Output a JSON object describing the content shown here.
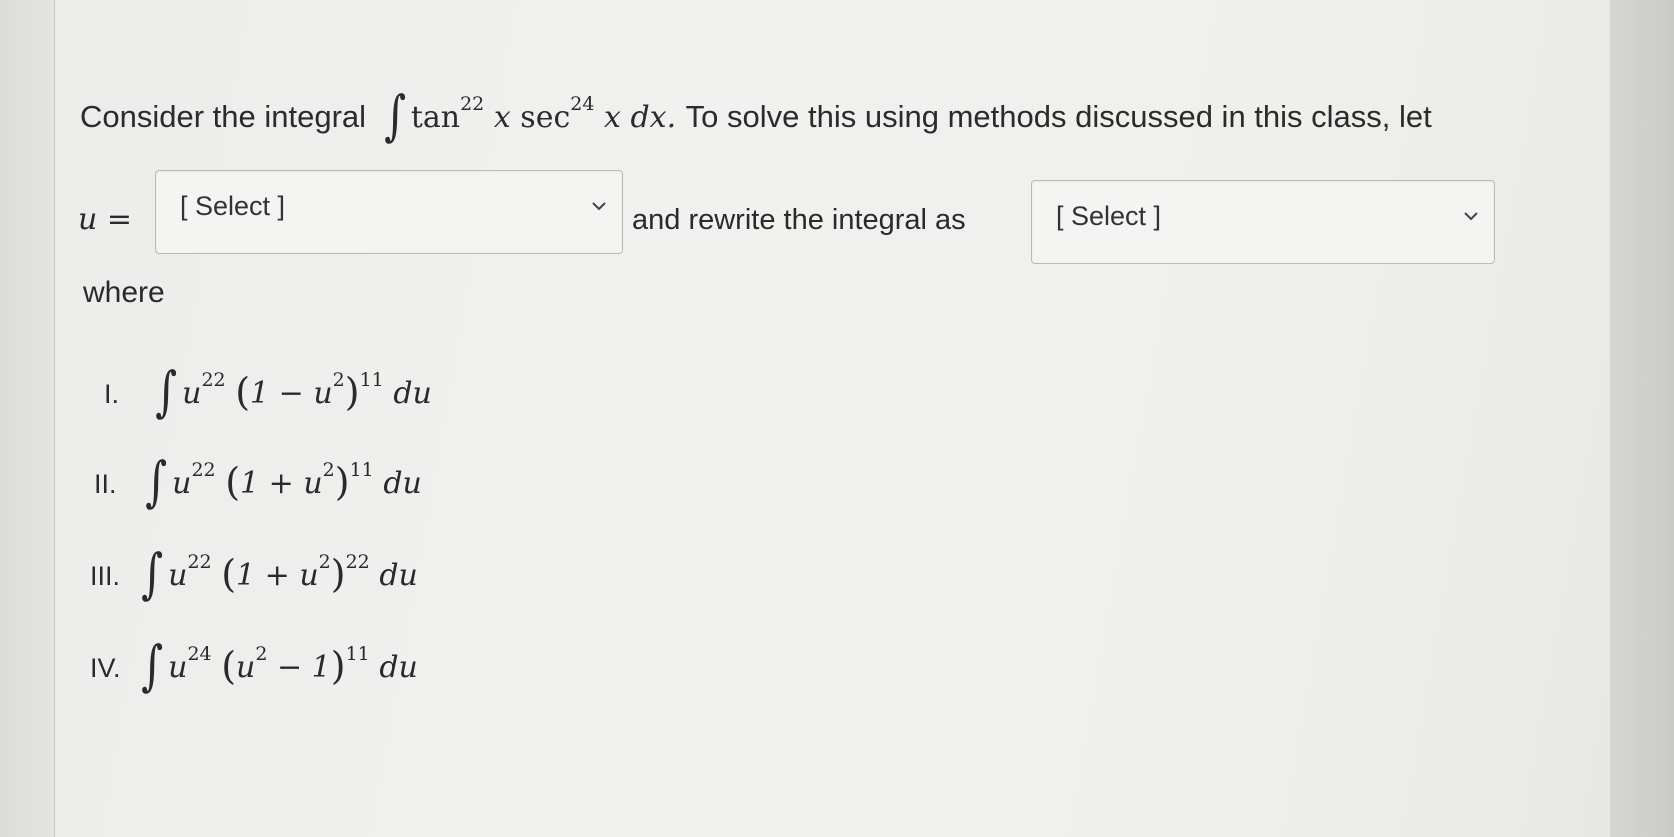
{
  "question": {
    "intro_text": "Consider the integral",
    "integrand": {
      "f1": "tan",
      "f1_exp": "22",
      "var1": "x",
      "f2": "sec",
      "f2_exp": "24",
      "var2": "x",
      "differential": "dx."
    },
    "after_text": "To solve this using methods discussed in this class, let",
    "u_label": "u =",
    "select1": {
      "label": "[ Select ]",
      "icon": "chevron-down-icon"
    },
    "middle_text": "and rewrite the integral as",
    "select2": {
      "label": "[ Select ]",
      "icon": "chevron-down-icon"
    },
    "where_text": "where"
  },
  "options": [
    {
      "numeral": "I.",
      "u_exp": "22",
      "inner": "1 − u",
      "inner_exp": "2",
      "outer_exp": "11",
      "differential": "du"
    },
    {
      "numeral": "II.",
      "u_exp": "22",
      "inner": "1 + u",
      "inner_exp": "2",
      "outer_exp": "11",
      "differential": "du"
    },
    {
      "numeral": "III.",
      "u_exp": "22",
      "inner": "1 + u",
      "inner_exp": "2",
      "outer_exp": "22",
      "differential": "du"
    },
    {
      "numeral": "IV.",
      "u_exp": "24",
      "inner_a": "u",
      "inner_exp": "2",
      "inner_b": " − 1",
      "outer_exp": "11",
      "differential": "du"
    }
  ],
  "colors": {
    "panel_background": "#f1f1ef",
    "select_border": "#b9b9b6",
    "text": "#2b2b2b"
  }
}
